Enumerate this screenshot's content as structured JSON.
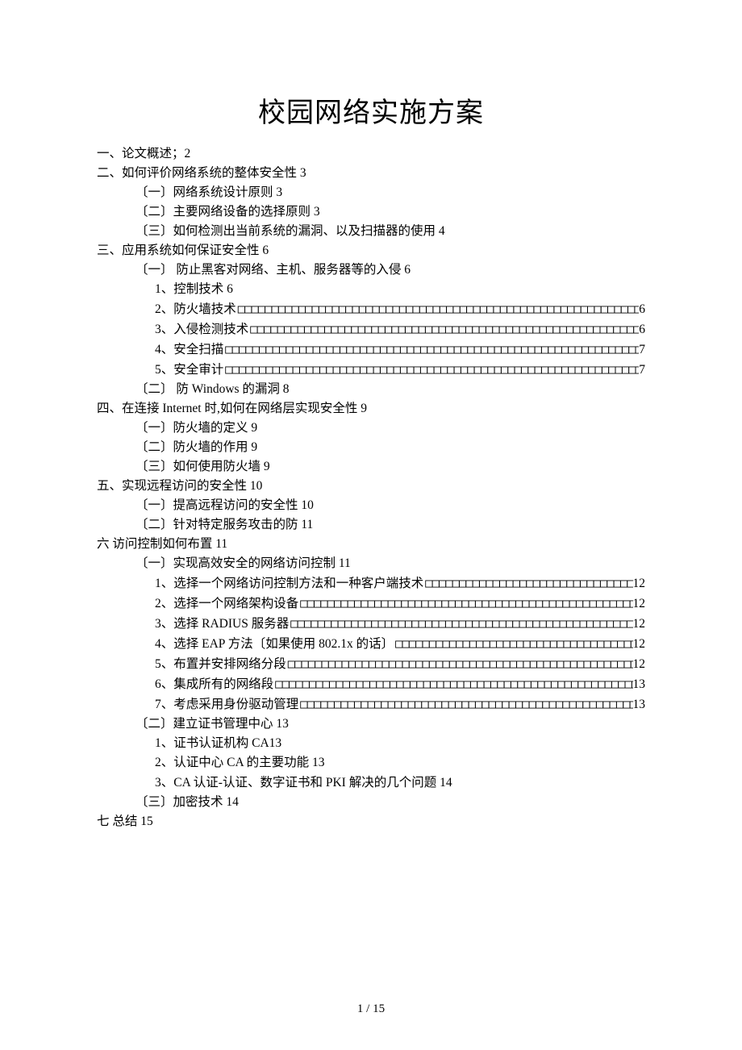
{
  "title": "校园网络实施方案",
  "footer": {
    "current": "1",
    "sep": " / ",
    "total": "15"
  },
  "toc": {
    "s1": "一、论文概述；2",
    "s2": {
      "head": "二、如何评价网络系统的整体安全性 3",
      "a": "〔一〕网络系统设计原则 3",
      "b": "〔二〕主要网络设备的选择原则 3",
      "c": "〔三〕如何检测出当前系统的漏洞、以及扫描器的使用 4"
    },
    "s3": {
      "head": "三、应用系统如何保证安全性 6",
      "a": {
        "head": "〔一〕 防止黑客对网络、主机、服务器等的入侵 6",
        "i1": "1、控制技术 6",
        "i2_label": "2、防火墙技术",
        "i2_pg": "6",
        "i3_label": "3、入侵检测技术",
        "i3_pg": "6",
        "i4_label": "4、安全扫描",
        "i4_pg": "7",
        "i5_label": "5、安全审计",
        "i5_pg": "7"
      },
      "b": "〔二〕 防 Windows 的漏洞 8"
    },
    "s4": {
      "head": "四、在连接 Internet 时,如何在网络层实现安全性 9",
      "a": "〔一〕防火墙的定义 9",
      "b": "〔二〕防火墙的作用 9",
      "c": "〔三〕如何使用防火墙 9"
    },
    "s5": {
      "head": "五、实现远程访问的安全性 10",
      "a": "〔一〕提高远程访问的安全性 10",
      "b": "〔二〕针对特定服务攻击的防 11"
    },
    "s6": {
      "head": "六 访问控制如何布置 11",
      "a": {
        "head": "〔一〕实现高效安全的网络访问控制 11",
        "i1_label": "1、选择一个网络访问控制方法和一种客户端技术",
        "i1_pg": "12",
        "i2_label": "2、选择一个网络架构设备",
        "i2_pg": "12",
        "i3_label": "3、选择 RADIUS 服务器",
        "i3_pg": "12",
        "i4_label": "4、选择 EAP 方法〔如果使用 802.1x 的话〕",
        "i4_pg": "12",
        "i5_label": "5、布置并安排网络分段",
        "i5_pg": "12",
        "i6_label": "6、集成所有的网络段",
        "i6_pg": "13",
        "i7_label": "7、考虑采用身份驱动管理",
        "i7_pg": "13"
      },
      "b": {
        "head": "〔二〕建立证书管理中心 13",
        "i1": "1、证书认证机构 CA13",
        "i2": "2、认证中心 CA 的主要功能 13",
        "i3": "3、CA 认证-认证、数字证书和 PKI 解决的几个问题 14"
      },
      "c": "〔三〕加密技术 14"
    },
    "s7": "七 总结 15"
  }
}
